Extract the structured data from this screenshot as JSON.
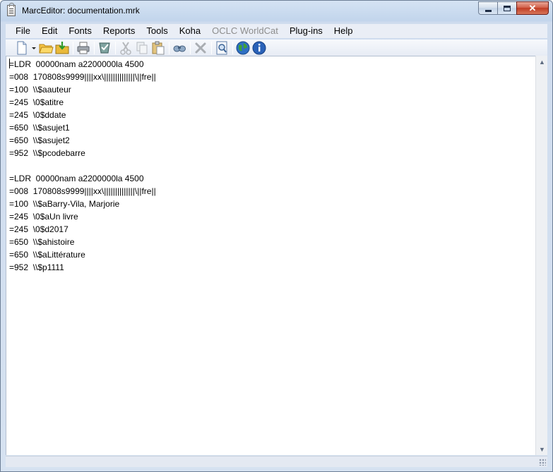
{
  "window": {
    "title": "MarcEditor: documentation.mrk"
  },
  "menu": [
    {
      "label": "File",
      "enabled": true
    },
    {
      "label": "Edit",
      "enabled": true
    },
    {
      "label": "Fonts",
      "enabled": true
    },
    {
      "label": "Reports",
      "enabled": true
    },
    {
      "label": "Tools",
      "enabled": true
    },
    {
      "label": "Koha",
      "enabled": true
    },
    {
      "label": "OCLC WorldCat",
      "enabled": false
    },
    {
      "label": "Plug-ins",
      "enabled": true
    },
    {
      "label": "Help",
      "enabled": true
    }
  ],
  "toolbar": {
    "icons": [
      "new-document-icon",
      "dropdown-arrow-icon",
      "open-folder-icon",
      "save-icon",
      "print-icon",
      "validate-icon",
      "cut-icon",
      "copy-icon",
      "paste-icon",
      "find-icon",
      "delete-icon",
      "preview-icon",
      "globe-icon",
      "info-icon"
    ]
  },
  "editor": {
    "lines": [
      "=LDR  00000nam a2200000la 4500",
      "=008  170808s9999||||xx\\||||||||||||||\\||fre||",
      "=100  \\\\$aauteur",
      "=245  \\0$atitre",
      "=245  \\0$ddate",
      "=650  \\\\$asujet1",
      "=650  \\\\$asujet2",
      "=952  \\\\$pcodebarre",
      "",
      "=LDR  00000nam a2200000la 4500",
      "=008  170808s9999||||xx\\||||||||||||||\\||fre||",
      "=100  \\\\$aBarry-Vila, Marjorie",
      "=245  \\0$aUn livre",
      "=245  \\0$d2017",
      "=650  \\\\$ahistoire",
      "=650  \\\\$aLittérature",
      "=952  \\\\$p1111"
    ]
  },
  "colors": {
    "titlebar": "#c2d5ec",
    "close_button": "#c03c24",
    "disabled_text": "#8d8d8d"
  }
}
